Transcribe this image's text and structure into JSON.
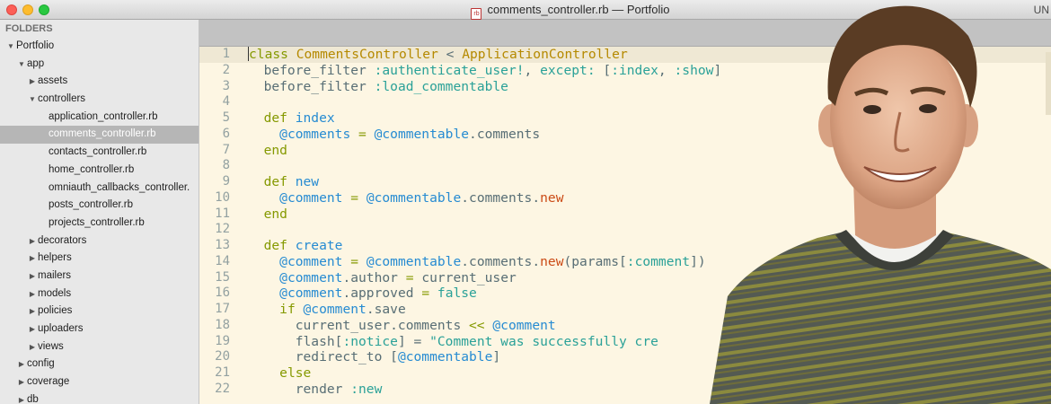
{
  "window": {
    "title": "comments_controller.rb — Portfolio",
    "file_badge": "rb",
    "right_text": "UN"
  },
  "sidebar": {
    "header": "FOLDERS",
    "items": [
      {
        "label": "Portfolio",
        "depth": 0,
        "arrow": "open"
      },
      {
        "label": "app",
        "depth": 1,
        "arrow": "open"
      },
      {
        "label": "assets",
        "depth": 2,
        "arrow": "closed"
      },
      {
        "label": "controllers",
        "depth": 2,
        "arrow": "open"
      },
      {
        "label": "application_controller.rb",
        "depth": 3,
        "arrow": "none"
      },
      {
        "label": "comments_controller.rb",
        "depth": 3,
        "arrow": "none",
        "selected": true
      },
      {
        "label": "contacts_controller.rb",
        "depth": 3,
        "arrow": "none"
      },
      {
        "label": "home_controller.rb",
        "depth": 3,
        "arrow": "none"
      },
      {
        "label": "omniauth_callbacks_controller.",
        "depth": 3,
        "arrow": "none"
      },
      {
        "label": "posts_controller.rb",
        "depth": 3,
        "arrow": "none"
      },
      {
        "label": "projects_controller.rb",
        "depth": 3,
        "arrow": "none"
      },
      {
        "label": "decorators",
        "depth": 2,
        "arrow": "closed"
      },
      {
        "label": "helpers",
        "depth": 2,
        "arrow": "closed"
      },
      {
        "label": "mailers",
        "depth": 2,
        "arrow": "closed"
      },
      {
        "label": "models",
        "depth": 2,
        "arrow": "closed"
      },
      {
        "label": "policies",
        "depth": 2,
        "arrow": "closed"
      },
      {
        "label": "uploaders",
        "depth": 2,
        "arrow": "closed"
      },
      {
        "label": "views",
        "depth": 2,
        "arrow": "closed"
      },
      {
        "label": "config",
        "depth": 1,
        "arrow": "closed"
      },
      {
        "label": "coverage",
        "depth": 1,
        "arrow": "closed"
      },
      {
        "label": "db",
        "depth": 1,
        "arrow": "closed"
      }
    ]
  },
  "editor": {
    "current_line": 1,
    "lines": [
      {
        "n": "1",
        "tokens": [
          [
            "kw",
            "class "
          ],
          [
            "cls",
            "CommentsController"
          ],
          [
            "txt",
            " < "
          ],
          [
            "cls",
            "ApplicationController"
          ]
        ]
      },
      {
        "n": "2",
        "tokens": [
          [
            "txt",
            "  before_filter "
          ],
          [
            "sym",
            ":authenticate_user!"
          ],
          [
            "txt",
            ", "
          ],
          [
            "sym",
            "except:"
          ],
          [
            "txt",
            " ["
          ],
          [
            "sym",
            ":index"
          ],
          [
            "txt",
            ", "
          ],
          [
            "sym",
            ":show"
          ],
          [
            "txt",
            "]"
          ]
        ]
      },
      {
        "n": "3",
        "tokens": [
          [
            "txt",
            "  before_filter "
          ],
          [
            "sym",
            ":load_commentable"
          ]
        ]
      },
      {
        "n": "4",
        "tokens": []
      },
      {
        "n": "5",
        "tokens": [
          [
            "txt",
            "  "
          ],
          [
            "kw",
            "def "
          ],
          [
            "def",
            "index"
          ]
        ]
      },
      {
        "n": "6",
        "tokens": [
          [
            "txt",
            "    "
          ],
          [
            "ivar",
            "@comments"
          ],
          [
            "op",
            " = "
          ],
          [
            "ivar",
            "@commentable"
          ],
          [
            "txt",
            ".comments"
          ]
        ]
      },
      {
        "n": "7",
        "tokens": [
          [
            "txt",
            "  "
          ],
          [
            "kw",
            "end"
          ]
        ]
      },
      {
        "n": "8",
        "tokens": []
      },
      {
        "n": "9",
        "tokens": [
          [
            "txt",
            "  "
          ],
          [
            "kw",
            "def "
          ],
          [
            "def",
            "new"
          ]
        ]
      },
      {
        "n": "10",
        "tokens": [
          [
            "txt",
            "    "
          ],
          [
            "ivar",
            "@comment"
          ],
          [
            "op",
            " = "
          ],
          [
            "ivar",
            "@commentable"
          ],
          [
            "txt",
            ".comments."
          ],
          [
            "new",
            "new"
          ]
        ]
      },
      {
        "n": "11",
        "tokens": [
          [
            "txt",
            "  "
          ],
          [
            "kw",
            "end"
          ]
        ]
      },
      {
        "n": "12",
        "tokens": []
      },
      {
        "n": "13",
        "tokens": [
          [
            "txt",
            "  "
          ],
          [
            "kw",
            "def "
          ],
          [
            "def",
            "create"
          ]
        ]
      },
      {
        "n": "14",
        "tokens": [
          [
            "txt",
            "    "
          ],
          [
            "ivar",
            "@comment"
          ],
          [
            "op",
            " = "
          ],
          [
            "ivar",
            "@commentable"
          ],
          [
            "txt",
            ".comments."
          ],
          [
            "new",
            "new"
          ],
          [
            "txt",
            "(params["
          ],
          [
            "sym",
            ":comment"
          ],
          [
            "txt",
            "])"
          ]
        ]
      },
      {
        "n": "15",
        "tokens": [
          [
            "txt",
            "    "
          ],
          [
            "ivar",
            "@comment"
          ],
          [
            "txt",
            ".author "
          ],
          [
            "op",
            "="
          ],
          [
            "txt",
            " current_user"
          ]
        ]
      },
      {
        "n": "16",
        "tokens": [
          [
            "txt",
            "    "
          ],
          [
            "ivar",
            "@comment"
          ],
          [
            "txt",
            ".approved "
          ],
          [
            "op",
            "="
          ],
          [
            "sym",
            " false"
          ]
        ]
      },
      {
        "n": "17",
        "tokens": [
          [
            "txt",
            "    "
          ],
          [
            "kw",
            "if "
          ],
          [
            "ivar",
            "@comment"
          ],
          [
            "txt",
            ".save"
          ]
        ]
      },
      {
        "n": "18",
        "tokens": [
          [
            "txt",
            "      current_user.comments "
          ],
          [
            "op",
            "<<"
          ],
          [
            "txt",
            " "
          ],
          [
            "ivar",
            "@comment"
          ]
        ]
      },
      {
        "n": "19",
        "tokens": [
          [
            "txt",
            "      flash["
          ],
          [
            "sym",
            ":notice"
          ],
          [
            "txt",
            "] = "
          ],
          [
            "str",
            "\"Comment was successfully cre"
          ]
        ]
      },
      {
        "n": "20",
        "tokens": [
          [
            "txt",
            "      redirect_to ["
          ],
          [
            "ivar",
            "@commentable"
          ],
          [
            "txt",
            "]"
          ]
        ]
      },
      {
        "n": "21",
        "tokens": [
          [
            "txt",
            "    "
          ],
          [
            "kw",
            "else"
          ]
        ]
      },
      {
        "n": "22",
        "tokens": [
          [
            "txt",
            "      render "
          ],
          [
            "sym",
            ":new"
          ]
        ]
      }
    ]
  },
  "colors": {
    "editor_bg": "#fdf6e3",
    "keyword": "#859900",
    "class_name": "#b58900",
    "method_name": "#268bd2",
    "symbol": "#2aa198",
    "new_call": "#cb4b16"
  },
  "overlay": {
    "description_icon": "person-photo"
  }
}
